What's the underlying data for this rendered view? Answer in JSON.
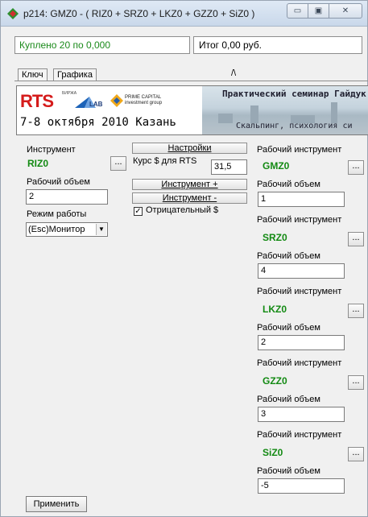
{
  "window": {
    "title": "p214: GMZ0 - ( RIZ0 + SRZ0 + LKZ0 + GZZ0 + SiZ0 )",
    "minimize_glyph": "▭",
    "maximize_glyph": "▣",
    "close_glyph": "✕"
  },
  "status": {
    "bought_text": "Куплено 20 по 0,000",
    "total_text": "Итог 0,00 руб."
  },
  "tabs": [
    {
      "label": "Ключ"
    },
    {
      "label": "Графика"
    }
  ],
  "tab_caret": "/\\",
  "banner": {
    "rts_logo": "RTS",
    "rts_small": "БИРЖА",
    "slab_text": "LAB",
    "prime_text_1": "PRIME CAPITAL",
    "prime_text_2": "investment group",
    "headline": "Практический семинар Гайдук",
    "date_text": "7-8 октября 2010 Казань",
    "subline": "Скальпинг, психология си"
  },
  "left": {
    "instrument_label": "Инструмент",
    "instrument_code": "RIZ0",
    "volume_label": "Рабочий объем",
    "volume_value": "2",
    "mode_label": "Режим работы",
    "mode_value": "(Esc)Монитор"
  },
  "middle": {
    "settings_button": "Настройки",
    "rate_label": "Курс $ для RTS",
    "rate_value": "31,5",
    "instrument_plus_button": "Инструмент +",
    "instrument_minus_button": "Инструмент -",
    "negative_label": "Отрицательный $",
    "negative_checked": true
  },
  "right": {
    "items": [
      {
        "label": "Рабочий инструмент",
        "code": "GMZ0",
        "volume_label": "Рабочий объем",
        "volume": "1"
      },
      {
        "label": "Рабочий инструмент",
        "code": "SRZ0",
        "volume_label": "Рабочий объем",
        "volume": "4"
      },
      {
        "label": "Рабочий инструмент",
        "code": "LKZ0",
        "volume_label": "Рабочий объем",
        "volume": "2"
      },
      {
        "label": "Рабочий инструмент",
        "code": "GZZ0",
        "volume_label": "Рабочий объем",
        "volume": "3"
      },
      {
        "label": "Рабочий инструмент",
        "code": "SiZ0",
        "volume_label": "Рабочий объем",
        "volume": "-5"
      }
    ]
  },
  "dots_label": "...",
  "apply_button": "Применить",
  "colors": {
    "code_green": "#138a13",
    "status_green": "#1a8a1a",
    "rts_red": "#d51b1b"
  }
}
